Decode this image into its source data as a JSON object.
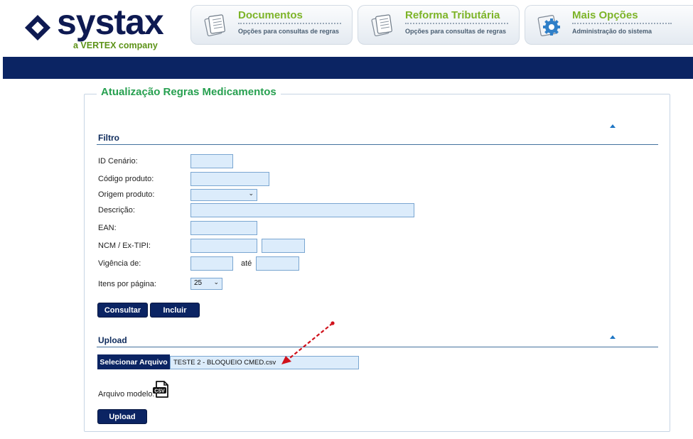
{
  "brand": {
    "name": "systax",
    "tagline": "a VERTEX company"
  },
  "nav": [
    {
      "title": "Documentos",
      "subtitle": "Opções para consultas de regras",
      "icon": "documents-icon"
    },
    {
      "title": "Reforma Tributária",
      "subtitle": "Opções para consultas de regras",
      "icon": "documents-icon"
    },
    {
      "title": "Mais Opções",
      "subtitle": "Administração do sistema",
      "icon": "gear-icon"
    }
  ],
  "page": {
    "title": "Atualização Regras Medicamentos"
  },
  "filter": {
    "section_title": "Filtro",
    "fields": {
      "id_cenario": {
        "label": "ID Cenário:",
        "value": ""
      },
      "codigo_produto": {
        "label": "Código produto:",
        "value": ""
      },
      "origem_produto": {
        "label": "Origem produto:",
        "value": ""
      },
      "descricao": {
        "label": "Descrição:",
        "value": ""
      },
      "ean": {
        "label": "EAN:",
        "value": ""
      },
      "ncm": {
        "label": "NCM / Ex-TIPI:",
        "value": "",
        "ex_value": ""
      },
      "vigencia": {
        "label": "Vigência de:",
        "from": "",
        "to_label": "até",
        "to": ""
      },
      "itens_por_pagina": {
        "label": "Itens por página:",
        "value": "25"
      }
    },
    "consultar_label": "Consultar",
    "incluir_label": "Incluir"
  },
  "upload": {
    "section_title": "Upload",
    "select_file_label": "Selecionar Arquivo",
    "file_name": "TESTE 2 - BLOQUEIO CMED.csv",
    "template_label": "Arquivo modelo:",
    "template_icon_text": "CSV",
    "upload_label": "Upload"
  },
  "colors": {
    "navy": "#0b2463",
    "green_title": "#27a050",
    "nav_green": "#7db428",
    "field_bg": "#dcecfb",
    "annotation_red": "#d0111b"
  }
}
